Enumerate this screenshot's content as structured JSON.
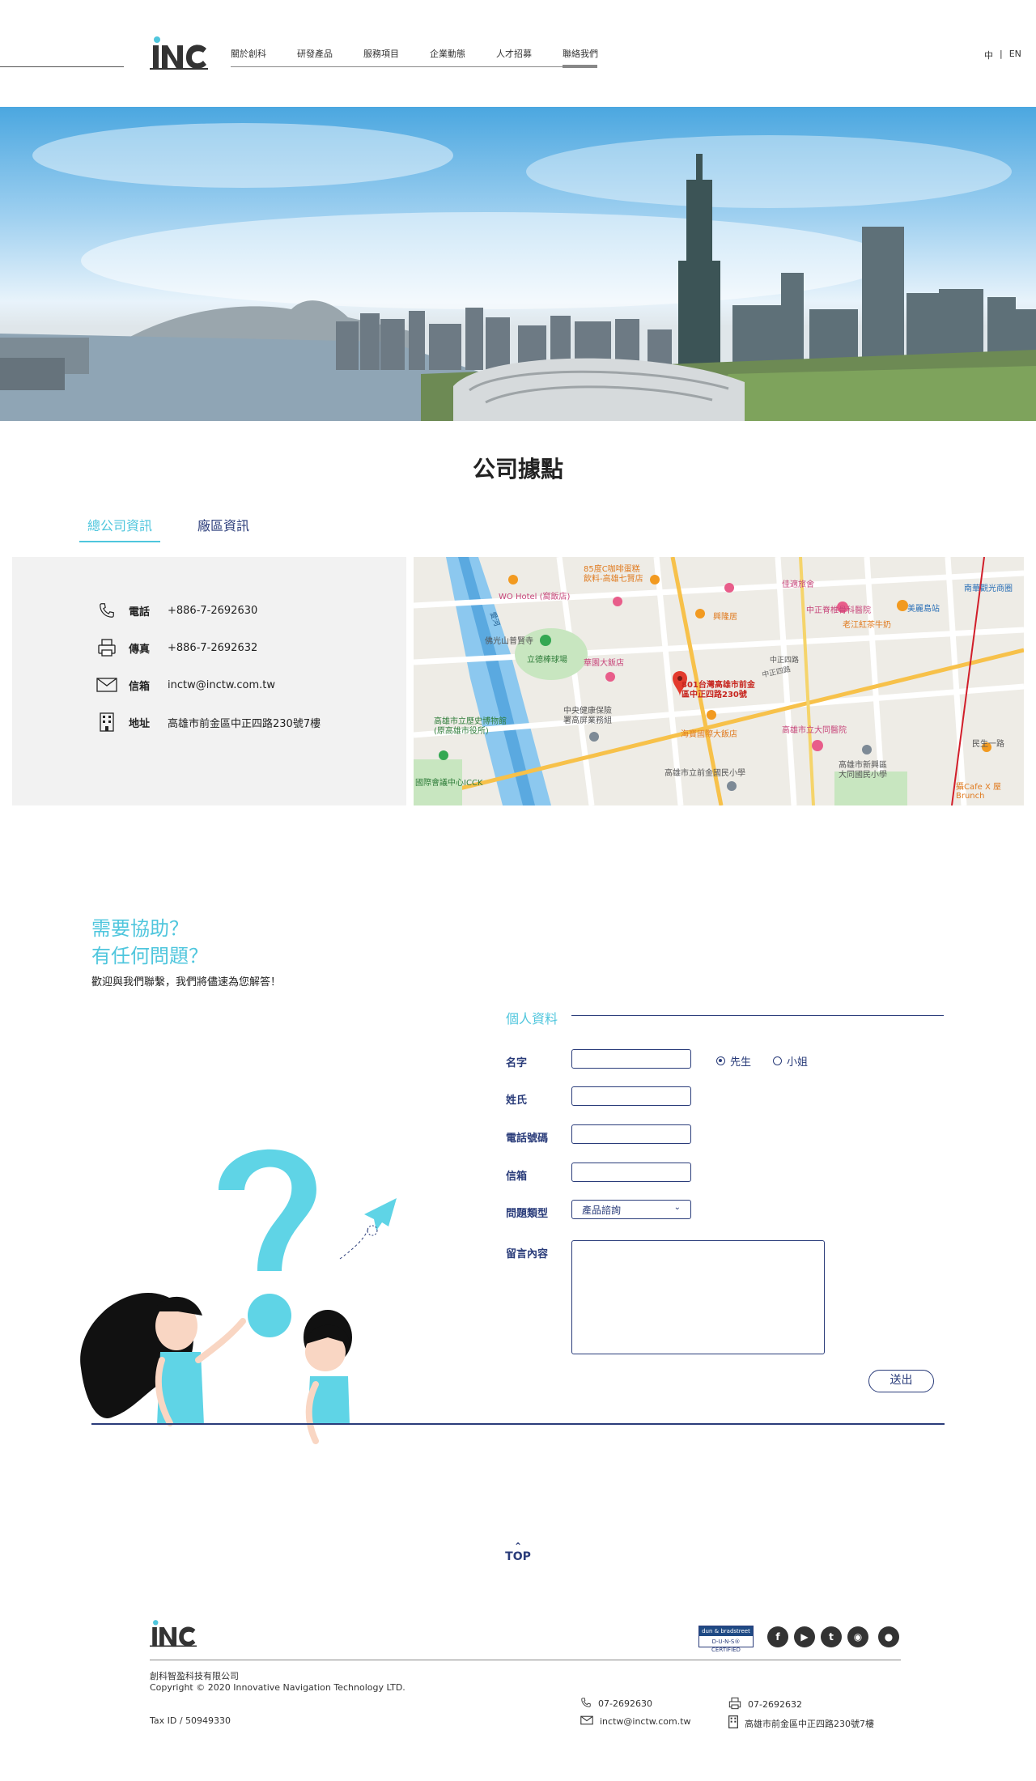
{
  "header": {
    "logo_text": "INC",
    "nav": [
      "關於創科",
      "研發產品",
      "服務項目",
      "企業動態",
      "人才招募",
      "聯絡我們"
    ],
    "active_nav": "聯絡我們",
    "lang": [
      "中",
      "|",
      "EN"
    ]
  },
  "page": {
    "title": "公司據點",
    "tabs": [
      "總公司資訊",
      "廠區資訊"
    ]
  },
  "company_info": {
    "phone_label": "電話",
    "phone": "+886-7-2692630",
    "fax_label": "傳真",
    "fax": "+886-7-2692632",
    "email_label": "信箱",
    "email": "inctw@inctw.com.tw",
    "address_label": "地址",
    "address": "高雄市前金區中正四路230號7樓"
  },
  "map": {
    "pin_label_1": "801台灣高雄市前金",
    "pin_label_2": "區中正四路230號",
    "places": [
      "85度C咖啡蛋糕",
      "飲料-高雄七賢店",
      "WO Hotel (窩飯店)",
      "佳適旅舍",
      "美麗島站",
      "興隆居",
      "中正脊椎骨科醫院",
      "老江紅茶牛奶",
      "佛光山普賢寺",
      "立德棒球場",
      "華園大飯店",
      "中正四路",
      "南華觀光商圈",
      "中央健康保險",
      "署高屏業務組",
      "高雄市立歷史博物館",
      "(原高雄市役所)",
      "海寶國際大飯店",
      "高雄市立大同醫院",
      "民生一路",
      "高雄市立前金國民小學",
      "高雄市新興區",
      "大同國民小學",
      "國際會議中心ICCK",
      "攝Cafe X 屋 Brunch",
      "愛河",
      "中正四路"
    ]
  },
  "contact": {
    "title_line1": "需要協助？",
    "title_line2": "有任何問題？",
    "subtitle": "歡迎與我們聯繫，我們將儘速為您解答！",
    "form_head": "個人資料",
    "labels": {
      "name": "名字",
      "surname": "姓氏",
      "phone": "電話號碼",
      "email": "信箱",
      "type": "問題類型",
      "message": "留言內容"
    },
    "radio_mr": "先生",
    "radio_ms": "小姐",
    "type_selected": "產品諮詢",
    "send": "送出"
  },
  "top_label": "TOP",
  "footer": {
    "company": "創科智盈科技有限公司",
    "copyright": "Copyright © 2020 Innovative Navigation Technology LTD.",
    "tax": "Tax ID / 50949330",
    "dnb_top": "dun & bradstreet",
    "dnb_bottom": "D-U-N-S® CERTIFIED",
    "phone": "07-2692630",
    "fax": "07-2692632",
    "email": "inctw@inctw.com.tw",
    "address": "高雄市前金區中正四路230號7樓"
  },
  "colors": {
    "accent": "#4fc6dd",
    "navy": "#2a3c7a",
    "panel": "#f2f2f2"
  }
}
